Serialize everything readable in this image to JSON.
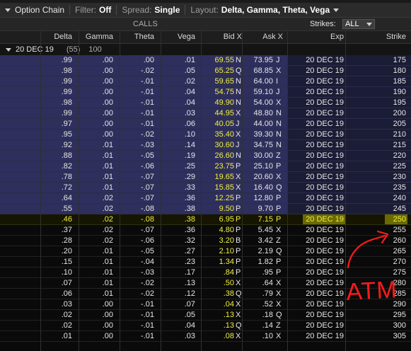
{
  "toolbar": {
    "section_title": "Option Chain",
    "filter_label": "Filter:",
    "filter_value": "Off",
    "spread_label": "Spread:",
    "spread_value": "Single",
    "layout_label": "Layout:",
    "layout_value": "Delta, Gamma, Theta, Vega"
  },
  "header": {
    "calls_label": "CALLS",
    "strikes_label": "Strikes:",
    "strikes_value": "ALL"
  },
  "columns": [
    "Delta",
    "Gamma",
    "Theta",
    "Vega",
    "Bid X",
    "Ask X",
    "Exp",
    "Strike"
  ],
  "group": {
    "expiration": "20 DEC 19",
    "days": "(55)",
    "multiplier": "100"
  },
  "rows": [
    {
      "delta": ".99",
      "gamma": ".00",
      "theta": ".00",
      "vega": ".01",
      "bid": "69.55",
      "bidex": "N",
      "ask": "73.95",
      "askex": "J",
      "exp": "20 DEC 19",
      "strike": "175",
      "state": "itm"
    },
    {
      "delta": ".98",
      "gamma": ".00",
      "theta": "-.02",
      "vega": ".05",
      "bid": "65.25",
      "bidex": "Q",
      "ask": "68.85",
      "askex": "X",
      "exp": "20 DEC 19",
      "strike": "180",
      "state": "itm"
    },
    {
      "delta": ".99",
      "gamma": ".00",
      "theta": "-.01",
      "vega": ".02",
      "bid": "59.65",
      "bidex": "N",
      "ask": "64.00",
      "askex": "I",
      "exp": "20 DEC 19",
      "strike": "185",
      "state": "itm"
    },
    {
      "delta": ".99",
      "gamma": ".00",
      "theta": "-.01",
      "vega": ".04",
      "bid": "54.75",
      "bidex": "N",
      "ask": "59.10",
      "askex": "J",
      "exp": "20 DEC 19",
      "strike": "190",
      "state": "itm"
    },
    {
      "delta": ".98",
      "gamma": ".00",
      "theta": "-.01",
      "vega": ".04",
      "bid": "49.90",
      "bidex": "N",
      "ask": "54.00",
      "askex": "X",
      "exp": "20 DEC 19",
      "strike": "195",
      "state": "itm"
    },
    {
      "delta": ".99",
      "gamma": ".00",
      "theta": "-.01",
      "vega": ".03",
      "bid": "44.95",
      "bidex": "X",
      "ask": "48.80",
      "askex": "N",
      "exp": "20 DEC 19",
      "strike": "200",
      "state": "itm"
    },
    {
      "delta": ".97",
      "gamma": ".00",
      "theta": "-.01",
      "vega": ".06",
      "bid": "40.05",
      "bidex": "J",
      "ask": "44.00",
      "askex": "N",
      "exp": "20 DEC 19",
      "strike": "205",
      "state": "itm"
    },
    {
      "delta": ".95",
      "gamma": ".00",
      "theta": "-.02",
      "vega": ".10",
      "bid": "35.40",
      "bidex": "X",
      "ask": "39.30",
      "askex": "N",
      "exp": "20 DEC 19",
      "strike": "210",
      "state": "itm"
    },
    {
      "delta": ".92",
      "gamma": ".01",
      "theta": "-.03",
      "vega": ".14",
      "bid": "30.60",
      "bidex": "J",
      "ask": "34.75",
      "askex": "N",
      "exp": "20 DEC 19",
      "strike": "215",
      "state": "itm"
    },
    {
      "delta": ".88",
      "gamma": ".01",
      "theta": "-.05",
      "vega": ".19",
      "bid": "26.60",
      "bidex": "N",
      "ask": "30.00",
      "askex": "Z",
      "exp": "20 DEC 19",
      "strike": "220",
      "state": "itm"
    },
    {
      "delta": ".82",
      "gamma": ".01",
      "theta": "-.06",
      "vega": ".25",
      "bid": "23.75",
      "bidex": "P",
      "ask": "25.10",
      "askex": "P",
      "exp": "20 DEC 19",
      "strike": "225",
      "state": "itm"
    },
    {
      "delta": ".78",
      "gamma": ".01",
      "theta": "-.07",
      "vega": ".29",
      "bid": "19.65",
      "bidex": "X",
      "ask": "20.60",
      "askex": "X",
      "exp": "20 DEC 19",
      "strike": "230",
      "state": "itm"
    },
    {
      "delta": ".72",
      "gamma": ".01",
      "theta": "-.07",
      "vega": ".33",
      "bid": "15.85",
      "bidex": "X",
      "ask": "16.40",
      "askex": "Q",
      "exp": "20 DEC 19",
      "strike": "235",
      "state": "itm"
    },
    {
      "delta": ".64",
      "gamma": ".02",
      "theta": "-.07",
      "vega": ".36",
      "bid": "12.25",
      "bidex": "P",
      "ask": "12.80",
      "askex": "P",
      "exp": "20 DEC 19",
      "strike": "240",
      "state": "itm"
    },
    {
      "delta": ".55",
      "gamma": ".02",
      "theta": "-.08",
      "vega": ".38",
      "bid": "9.50",
      "bidex": "P",
      "ask": "9.70",
      "askex": "P",
      "exp": "20 DEC 19",
      "strike": "245",
      "state": "itm"
    },
    {
      "delta": ".46",
      "gamma": ".02",
      "theta": "-.08",
      "vega": ".38",
      "bid": "6.95",
      "bidex": "P",
      "ask": "7.15",
      "askex": "P",
      "exp": "20 DEC 19",
      "strike": "250",
      "state": "atm"
    },
    {
      "delta": ".37",
      "gamma": ".02",
      "theta": "-.07",
      "vega": ".36",
      "bid": "4.80",
      "bidex": "P",
      "ask": "5.45",
      "askex": "X",
      "exp": "20 DEC 19",
      "strike": "255",
      "state": "otm"
    },
    {
      "delta": ".28",
      "gamma": ".02",
      "theta": "-.06",
      "vega": ".32",
      "bid": "3.20",
      "bidex": "B",
      "ask": "3.42",
      "askex": "Z",
      "exp": "20 DEC 19",
      "strike": "260",
      "state": "otm"
    },
    {
      "delta": ".20",
      "gamma": ".01",
      "theta": "-.05",
      "vega": ".27",
      "bid": "2.10",
      "bidex": "P",
      "ask": "2.19",
      "askex": "Q",
      "exp": "20 DEC 19",
      "strike": "265",
      "state": "otm"
    },
    {
      "delta": ".15",
      "gamma": ".01",
      "theta": "-.04",
      "vega": ".23",
      "bid": "1.34",
      "bidex": "P",
      "ask": "1.82",
      "askex": "P",
      "exp": "20 DEC 19",
      "strike": "270",
      "state": "otm"
    },
    {
      "delta": ".10",
      "gamma": ".01",
      "theta": "-.03",
      "vega": ".17",
      "bid": ".84",
      "bidex": "P",
      "ask": ".95",
      "askex": "P",
      "exp": "20 DEC 19",
      "strike": "275",
      "state": "otm"
    },
    {
      "delta": ".07",
      "gamma": ".01",
      "theta": "-.02",
      "vega": ".13",
      "bid": ".50",
      "bidex": "X",
      "ask": ".64",
      "askex": "X",
      "exp": "20 DEC 19",
      "strike": "280",
      "state": "otm"
    },
    {
      "delta": ".06",
      "gamma": ".01",
      "theta": "-.02",
      "vega": ".12",
      "bid": ".38",
      "bidex": "Q",
      "ask": ".79",
      "askex": "X",
      "exp": "20 DEC 19",
      "strike": "285",
      "state": "otm"
    },
    {
      "delta": ".03",
      "gamma": ".00",
      "theta": "-.01",
      "vega": ".07",
      "bid": ".04",
      "bidex": "X",
      "ask": ".52",
      "askex": "X",
      "exp": "20 DEC 19",
      "strike": "290",
      "state": "otm"
    },
    {
      "delta": ".02",
      "gamma": ".00",
      "theta": "-.01",
      "vega": ".05",
      "bid": ".13",
      "bidex": "X",
      "ask": ".18",
      "askex": "Q",
      "exp": "20 DEC 19",
      "strike": "295",
      "state": "otm"
    },
    {
      "delta": ".02",
      "gamma": ".00",
      "theta": "-.01",
      "vega": ".04",
      "bid": ".13",
      "bidex": "Q",
      "ask": ".14",
      "askex": "Z",
      "exp": "20 DEC 19",
      "strike": "300",
      "state": "otm"
    },
    {
      "delta": ".01",
      "gamma": ".00",
      "theta": "-.01",
      "vega": ".03",
      "bid": ".08",
      "bidex": "X",
      "ask": ".10",
      "askex": "X",
      "exp": "20 DEC 19",
      "strike": "305",
      "state": "otm"
    }
  ],
  "annotation": {
    "text": "ATM",
    "color": "#ff1a1a"
  },
  "colors": {
    "itm_row": "#2e2f5c",
    "atm_text": "#f0f040",
    "atm_highlight": "#6a6a00",
    "bid_text": "#f0f040"
  }
}
